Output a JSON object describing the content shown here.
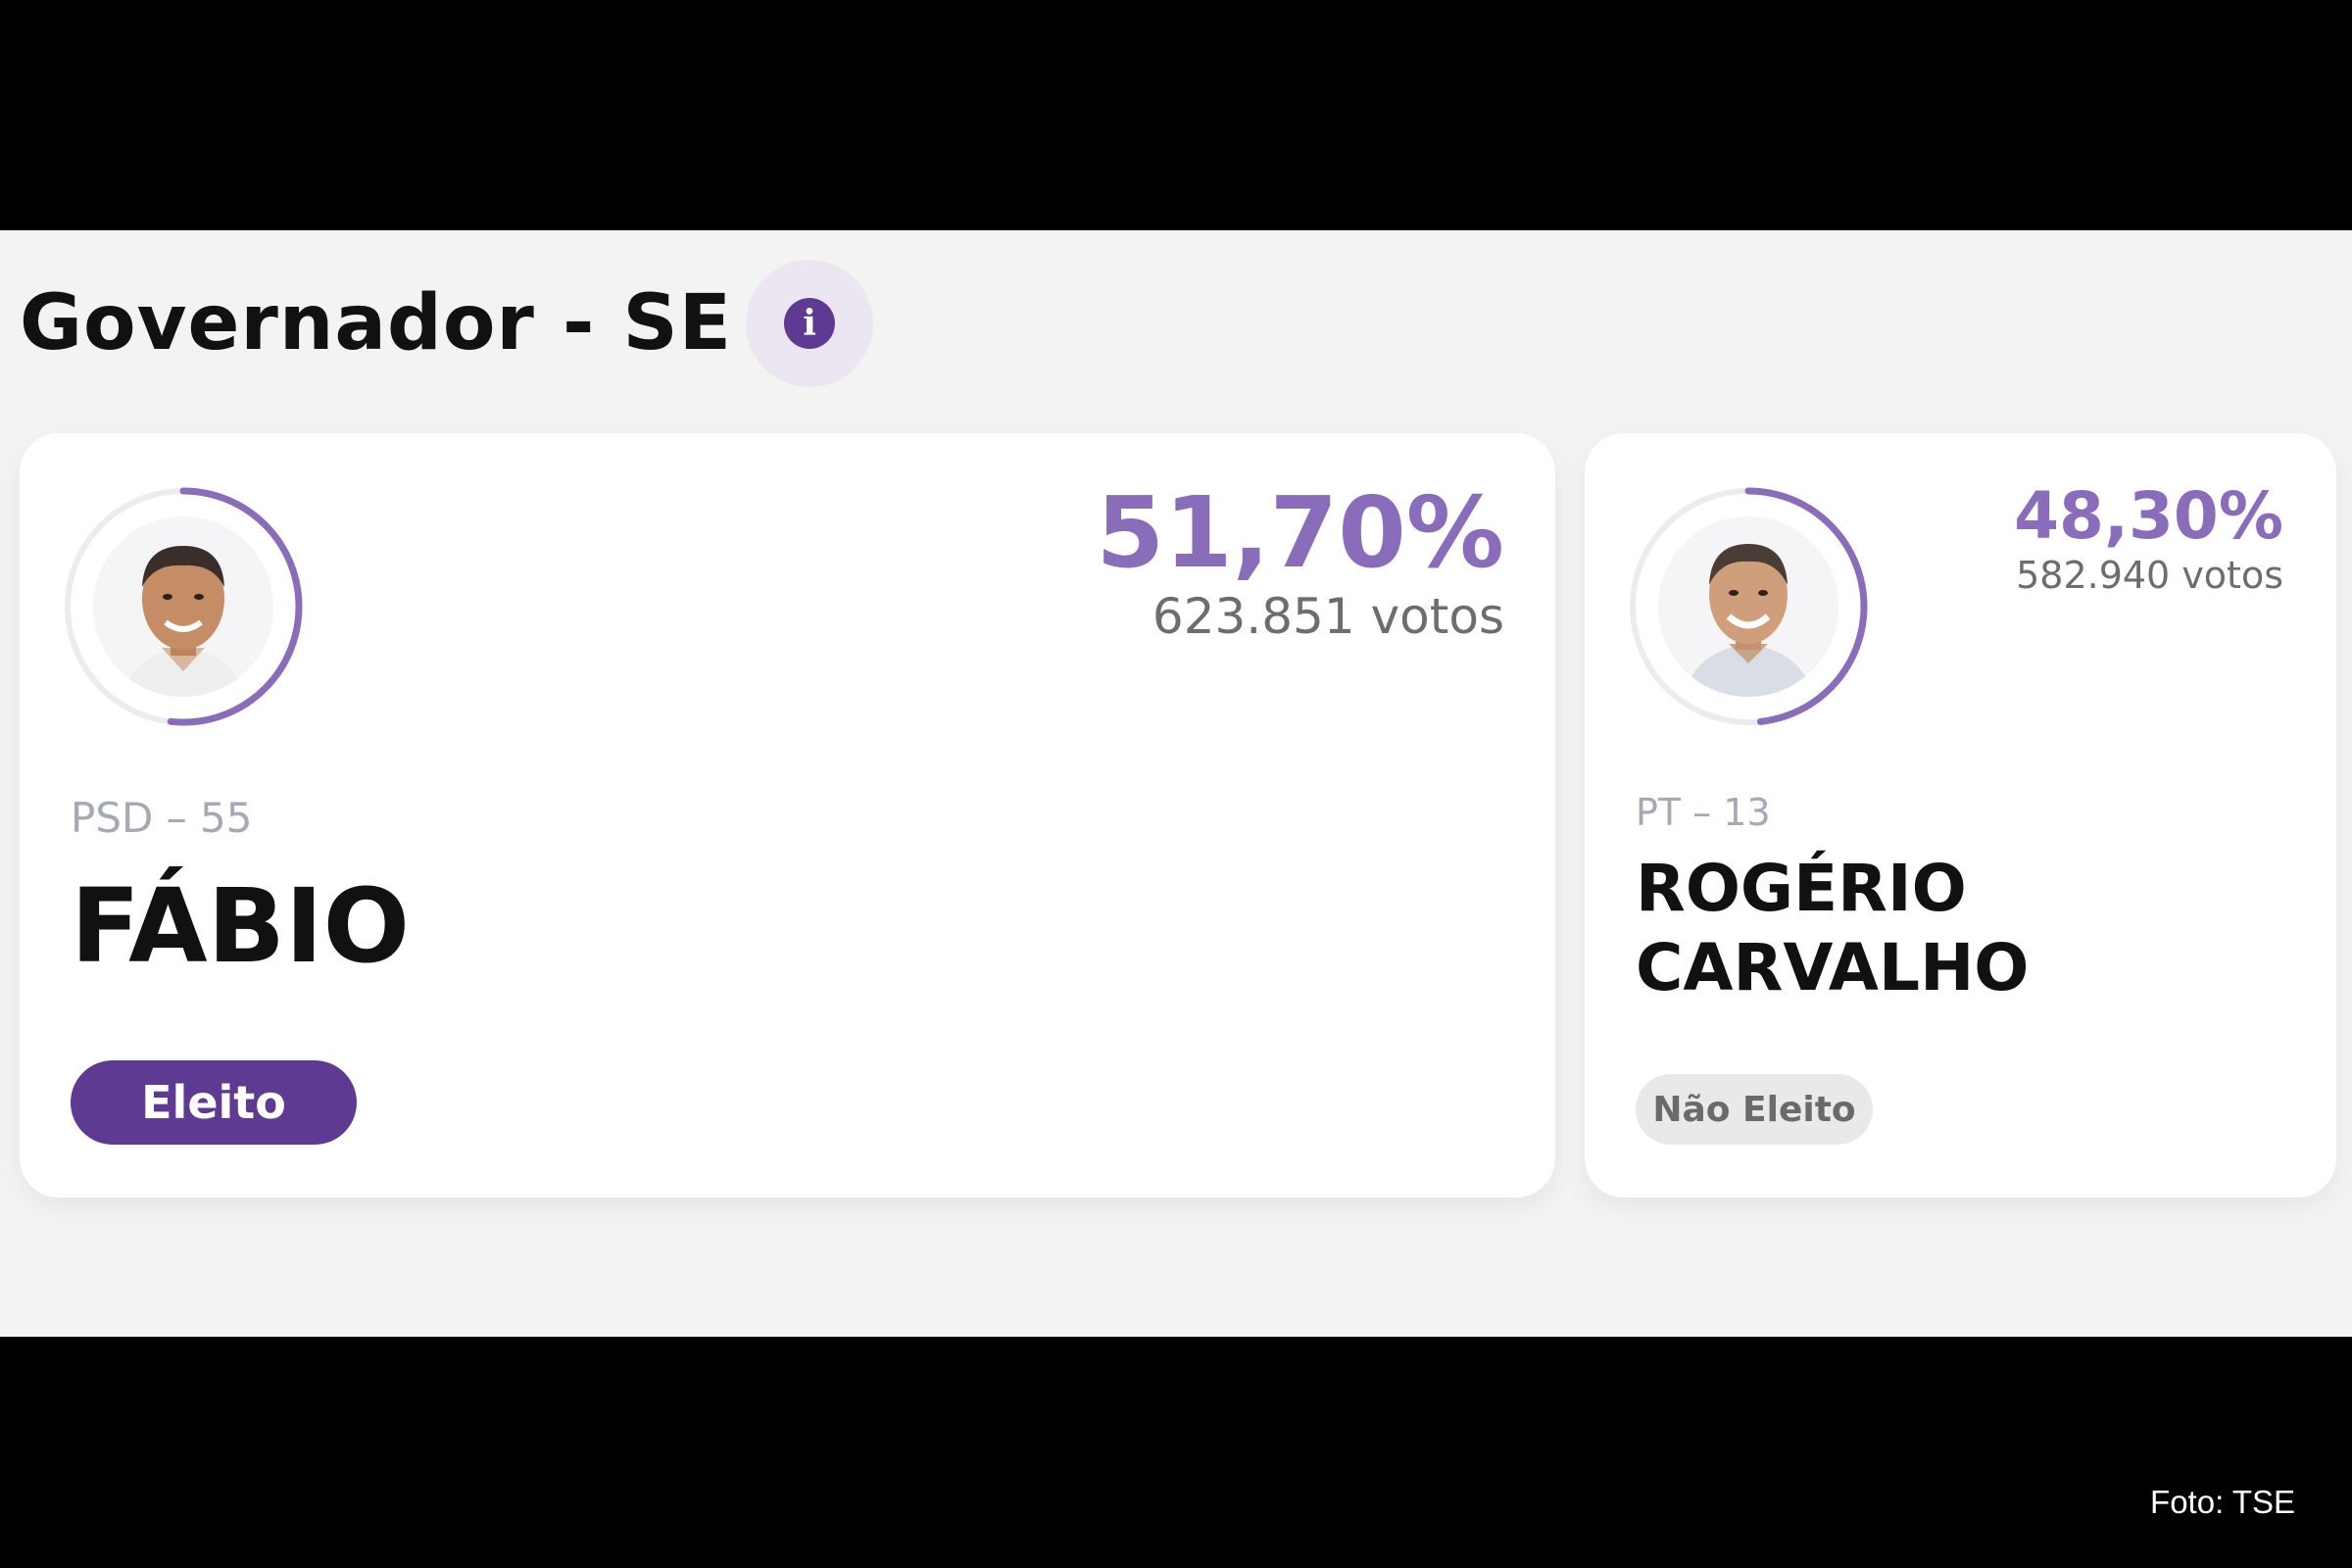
{
  "header": {
    "title": "Governador - SE",
    "info_icon": "info-icon"
  },
  "candidates": [
    {
      "percent": "51,70%",
      "percent_value": 51.7,
      "votes": "623.851 votos",
      "party": "PSD – 55",
      "name": "FÁBIO",
      "status": "Eleito",
      "status_color": "#5e3a92",
      "photo": "candidate-photo"
    },
    {
      "percent": "48,30%",
      "percent_value": 48.3,
      "votes": "582.940 votos",
      "party": "PT – 13",
      "name": "ROGÉRIO CARVALHO",
      "status": "Não Eleito",
      "status_color": "#e9e9e9",
      "photo": "candidate-photo"
    }
  ],
  "colors": {
    "accent": "#8a6dba",
    "brand": "#5e3a92",
    "panel_background": "#f3f3f3"
  },
  "credit": "Foto: TSE"
}
